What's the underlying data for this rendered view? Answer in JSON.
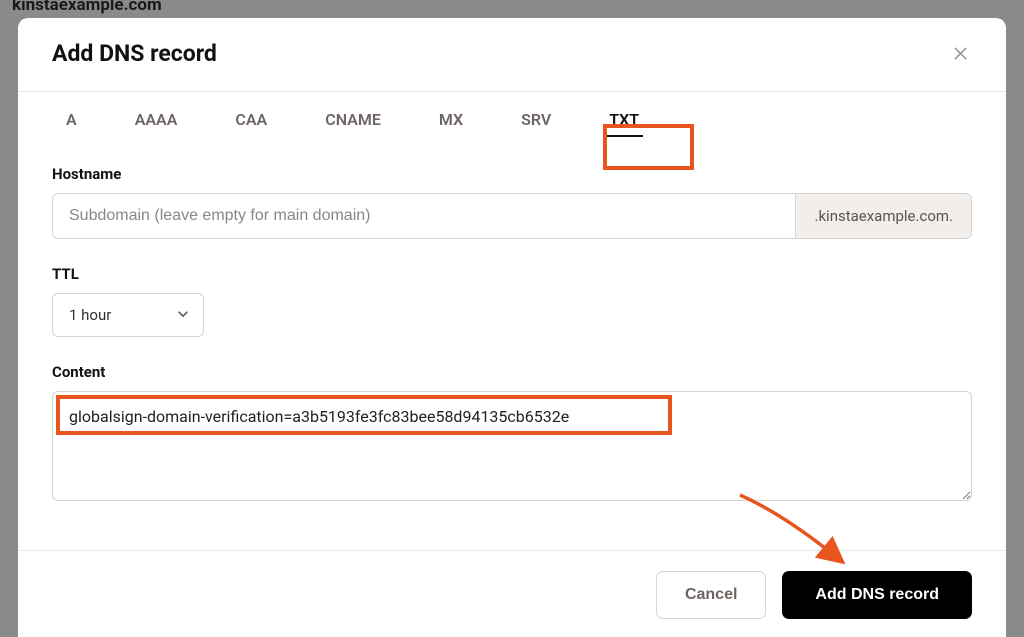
{
  "backdrop": {
    "partial_domain": "kinstaexample.com"
  },
  "modal": {
    "title": "Add DNS record",
    "tabs": [
      "A",
      "AAAA",
      "CAA",
      "CNAME",
      "MX",
      "SRV",
      "TXT"
    ],
    "active_tab": "TXT"
  },
  "fields": {
    "hostname": {
      "label": "Hostname",
      "placeholder": "Subdomain (leave empty for main domain)",
      "value": "",
      "suffix": ".kinstaexample.com."
    },
    "ttl": {
      "label": "TTL",
      "value": "1 hour"
    },
    "content": {
      "label": "Content",
      "value": "globalsign-domain-verification=a3b5193fe3fc83bee58d94135cb6532e"
    }
  },
  "footer": {
    "cancel": "Cancel",
    "submit": "Add DNS record"
  },
  "annotations": {
    "highlight_color": "#e8551f"
  }
}
